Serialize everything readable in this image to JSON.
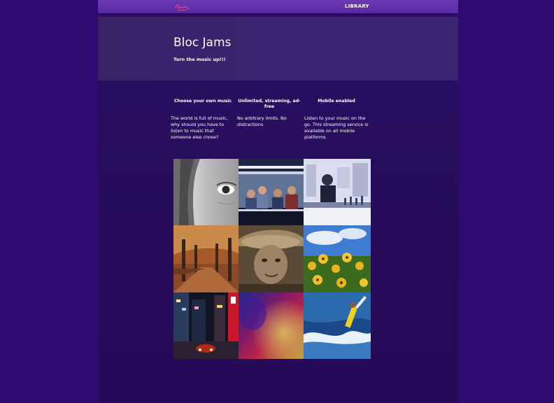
{
  "navbar": {
    "logo_icon": "bloc-jams-logo",
    "library_label": "LIBRARY"
  },
  "hero": {
    "title": "Bloc Jams",
    "subtitle": "Turn the music up!!!"
  },
  "features": [
    {
      "title": "Choose your own music",
      "text": "The world is full of music, why should you have to listen to music that someone else chose?"
    },
    {
      "title": "Unlimited, streaming, ad-free",
      "text": "No arbitrary limits. No distractions"
    },
    {
      "title": "Mobile enabled",
      "text": "Listen to your music on the go. This streaming service is available on all mobile platforms"
    }
  ],
  "gallery": {
    "images": [
      "woman-face-photo",
      "band-group-photo",
      "dj-bar-photo",
      "autumn-park-photo",
      "old-man-hat-photo",
      "yellow-flowers-photo",
      "city-night-photo",
      "color-blur-photo",
      "surfer-wave-photo"
    ]
  },
  "colors": {
    "page_bg": "#2f0a71",
    "nav_bg": "#5a2aa0",
    "hero_bg": "#3a2470",
    "container_bg": "#260c5b",
    "text": "#ffffff"
  }
}
